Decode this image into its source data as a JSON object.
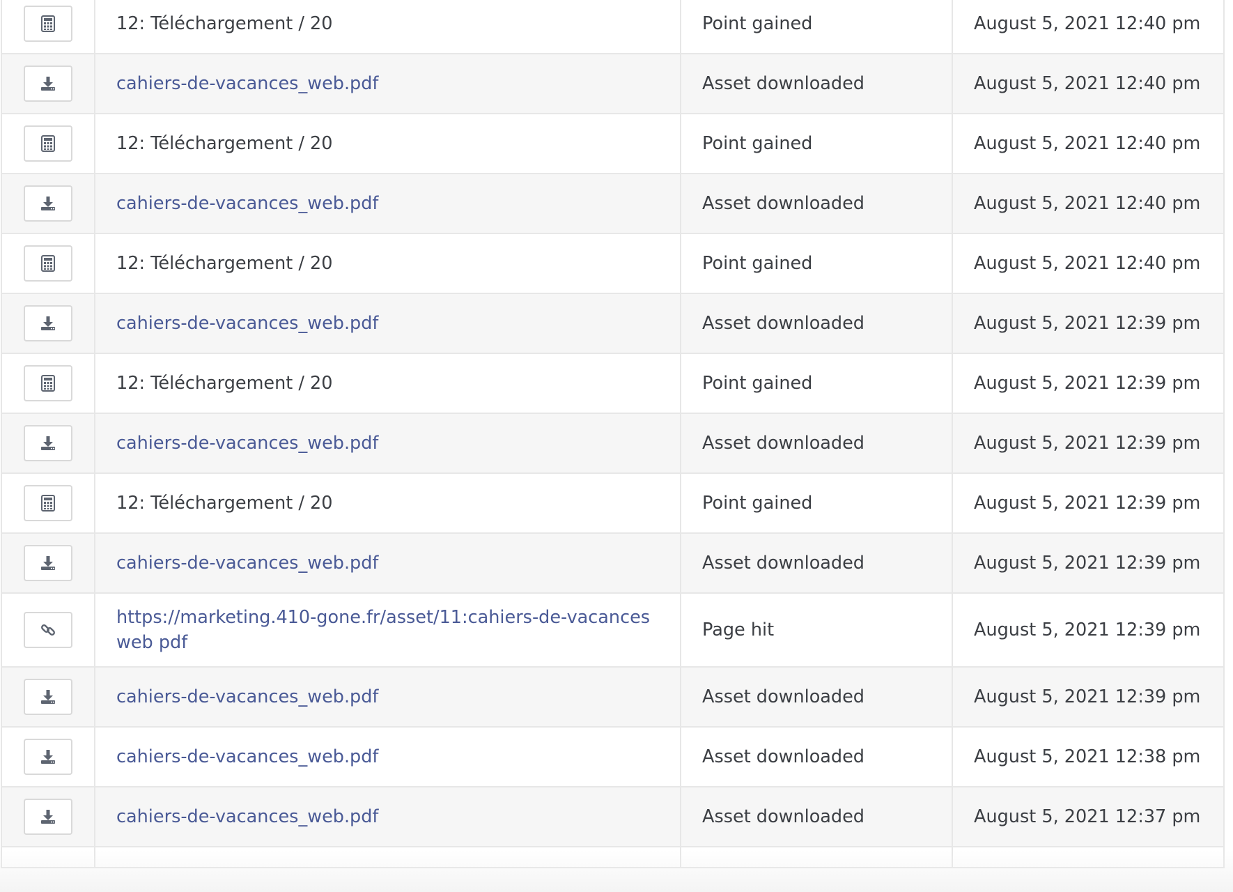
{
  "timeline": {
    "rows": [
      {
        "icon": "calculator-icon",
        "event": "12: Téléchargement / 20",
        "is_link": false,
        "type": "Point gained",
        "date": "August 5, 2021 12:40 pm"
      },
      {
        "icon": "download-icon",
        "event": "cahiers-de-vacances_web.pdf",
        "is_link": true,
        "type": "Asset downloaded",
        "date": "August 5, 2021 12:40 pm"
      },
      {
        "icon": "calculator-icon",
        "event": "12: Téléchargement / 20",
        "is_link": false,
        "type": "Point gained",
        "date": "August 5, 2021 12:40 pm"
      },
      {
        "icon": "download-icon",
        "event": "cahiers-de-vacances_web.pdf",
        "is_link": true,
        "type": "Asset downloaded",
        "date": "August 5, 2021 12:40 pm"
      },
      {
        "icon": "calculator-icon",
        "event": "12: Téléchargement / 20",
        "is_link": false,
        "type": "Point gained",
        "date": "August 5, 2021 12:40 pm"
      },
      {
        "icon": "download-icon",
        "event": "cahiers-de-vacances_web.pdf",
        "is_link": true,
        "type": "Asset downloaded",
        "date": "August 5, 2021 12:39 pm"
      },
      {
        "icon": "calculator-icon",
        "event": "12: Téléchargement / 20",
        "is_link": false,
        "type": "Point gained",
        "date": "August 5, 2021 12:39 pm"
      },
      {
        "icon": "download-icon",
        "event": "cahiers-de-vacances_web.pdf",
        "is_link": true,
        "type": "Asset downloaded",
        "date": "August 5, 2021 12:39 pm"
      },
      {
        "icon": "calculator-icon",
        "event": "12: Téléchargement / 20",
        "is_link": false,
        "type": "Point gained",
        "date": "August 5, 2021 12:39 pm"
      },
      {
        "icon": "download-icon",
        "event": "cahiers-de-vacances_web.pdf",
        "is_link": true,
        "type": "Asset downloaded",
        "date": "August 5, 2021 12:39 pm"
      },
      {
        "icon": "link-icon",
        "event": "https://marketing.410-gone.fr/asset/11:cahiers-de-vacancesweb pdf",
        "is_link": true,
        "type": "Page hit",
        "date": "August 5, 2021 12:39 pm"
      },
      {
        "icon": "download-icon",
        "event": "cahiers-de-vacances_web.pdf",
        "is_link": true,
        "type": "Asset downloaded",
        "date": "August 5, 2021 12:39 pm"
      },
      {
        "icon": "download-icon",
        "event": "cahiers-de-vacances_web.pdf",
        "is_link": true,
        "type": "Asset downloaded",
        "date": "August 5, 2021 12:38 pm"
      },
      {
        "icon": "download-icon",
        "event": "cahiers-de-vacances_web.pdf",
        "is_link": true,
        "type": "Asset downloaded",
        "date": "August 5, 2021 12:37 pm"
      }
    ]
  },
  "colors": {
    "link": "#4a5a96",
    "text": "#3c3f44",
    "row_alt": "#f6f6f6",
    "border": "#e7e7e7",
    "icon": "#5d6470"
  }
}
